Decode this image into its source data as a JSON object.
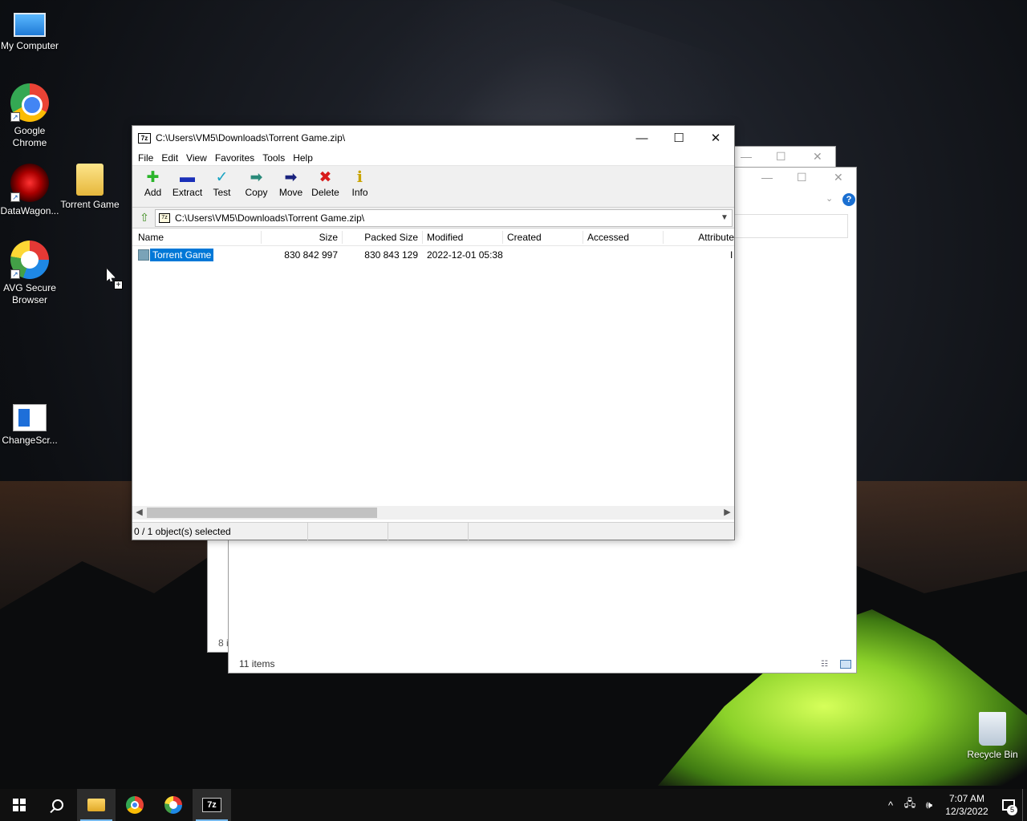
{
  "desktop": {
    "icons": [
      {
        "label": "My Computer"
      },
      {
        "label": "Google Chrome"
      },
      {
        "label": "DataWagon..."
      },
      {
        "label": "Torrent Game"
      },
      {
        "label": "AVG Secure Browser"
      },
      {
        "label": "ChangeScr..."
      },
      {
        "label": "Recycle Bin"
      }
    ]
  },
  "background_windows": {
    "status_fragment": "8 i",
    "items_count": "11 items",
    "help_label": "?"
  },
  "sevenzip": {
    "logo": "7z",
    "title": "C:\\Users\\VM5\\Downloads\\Torrent Game.zip\\",
    "window_controls": {
      "minimize": "—",
      "maximize": "☐",
      "close": "✕"
    },
    "menu": [
      "File",
      "Edit",
      "View",
      "Favorites",
      "Tools",
      "Help"
    ],
    "toolbar": [
      {
        "label": "Add",
        "icon": "plus-icon",
        "glyph": "✚",
        "color": "#2bb52b"
      },
      {
        "label": "Extract",
        "icon": "minus-icon",
        "glyph": "▬",
        "color": "#1a2fb8"
      },
      {
        "label": "Test",
        "icon": "check-icon",
        "glyph": "✓",
        "color": "#19a3c2"
      },
      {
        "label": "Copy",
        "icon": "copy-arrow-icon",
        "glyph": "➡",
        "color": "#2a8a7a"
      },
      {
        "label": "Move",
        "icon": "move-arrow-icon",
        "glyph": "➡",
        "color": "#1a237e"
      },
      {
        "label": "Delete",
        "icon": "delete-x-icon",
        "glyph": "✖",
        "color": "#d81b1b"
      },
      {
        "label": "Info",
        "icon": "info-icon",
        "glyph": "ℹ",
        "color": "#c9a400"
      }
    ],
    "address": "C:\\Users\\VM5\\Downloads\\Torrent Game.zip\\",
    "columns": [
      "Name",
      "Size",
      "Packed Size",
      "Modified",
      "Created",
      "Accessed",
      "Attribute"
    ],
    "rows": [
      {
        "name": "Torrent Game",
        "size": "830 842 997",
        "packed_size": "830 843 129",
        "modified": "2022-12-01 05:38",
        "created": "",
        "accessed": "",
        "attribute": "I"
      }
    ],
    "status": "0 / 1 object(s) selected"
  },
  "taskbar": {
    "sevenzip_label": "7z",
    "time": "7:07 AM",
    "date": "12/3/2022",
    "notification_count": "5",
    "tray": {
      "chevron": "^",
      "network": "🖧",
      "volume": "🕪"
    }
  }
}
